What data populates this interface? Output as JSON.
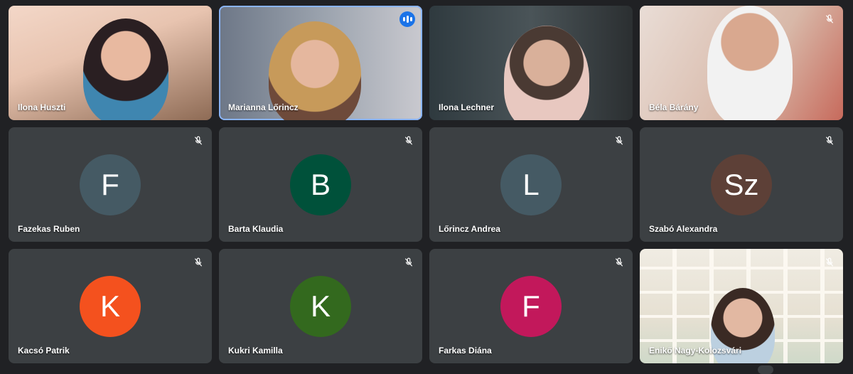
{
  "participants": [
    {
      "name": "Ilona Huszti",
      "video": true,
      "muted": false
    },
    {
      "name": "Marianna Lőrincz",
      "video": true,
      "speaking": true
    },
    {
      "name": "Ilona Lechner",
      "video": true,
      "muted": false
    },
    {
      "name": "Béla Bárány",
      "video": true,
      "muted": true
    },
    {
      "name": "Fazekas Ruben",
      "initial": "F",
      "color": "#455a64",
      "muted": true
    },
    {
      "name": "Barta Klaudia",
      "initial": "B",
      "color": "#00513a",
      "muted": true
    },
    {
      "name": "Lőrincz Andrea",
      "initial": "L",
      "color": "#455a64",
      "muted": true
    },
    {
      "name": "Szabó Alexandra",
      "initial": "Sz",
      "color": "#5d4037",
      "muted": true
    },
    {
      "name": "Kacsó Patrik",
      "initial": "K",
      "color": "#f4511e",
      "muted": true
    },
    {
      "name": "Kukri Kamilla",
      "initial": "K",
      "color": "#33691e",
      "muted": true
    },
    {
      "name": "Farkas Diána",
      "initial": "F",
      "color": "#c2185b",
      "muted": true
    },
    {
      "name": "Enikő Nagy-Kolozsvári",
      "video": true,
      "muted": true
    }
  ],
  "icons": {
    "mute": "mic-off-icon",
    "speaking": "audio-level-icon"
  }
}
